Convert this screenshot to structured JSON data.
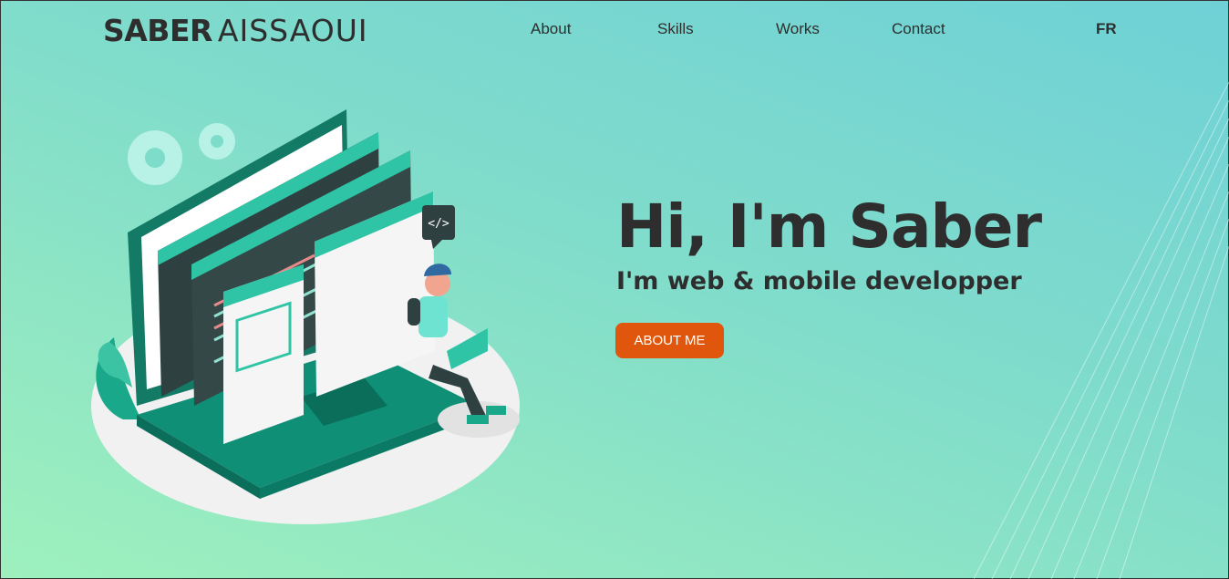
{
  "header": {
    "brand_first": "SABER",
    "brand_last": "AISSAOUI",
    "nav": [
      "About",
      "Skills",
      "Works",
      "Contact"
    ],
    "lang": "FR"
  },
  "hero": {
    "title": "Hi, I'm Saber",
    "subtitle": "I'm web & mobile developper",
    "button": "ABOUT ME",
    "code_badge": "</>"
  },
  "colors": {
    "accent_button": "#e0560d",
    "text_dark": "#2e2e2e",
    "illustration_teal": "#1aa88b",
    "illustration_dark": "#2f4040"
  },
  "icons": [
    "gear-icon",
    "code-icon",
    "image-icon",
    "laptop-icon"
  ]
}
